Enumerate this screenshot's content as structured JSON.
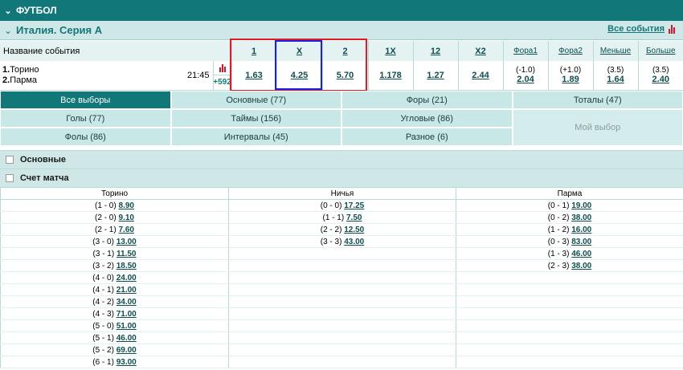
{
  "sport_title": "ФУТБОЛ",
  "league": {
    "name": "Италия. Серия А",
    "all_events": "Все события"
  },
  "odds_header": {
    "event_col": "Название события",
    "cols": [
      "1",
      "X",
      "2",
      "1X",
      "12",
      "X2",
      "Фора1",
      "Фора2",
      "Меньше",
      "Больше"
    ]
  },
  "event": {
    "team1_num": "1.",
    "team1": "Торино",
    "team2_num": "2.",
    "team2": "Парма",
    "time": "21:45",
    "more": "+592",
    "odds": [
      "1.63",
      "4.25",
      "5.70",
      "1.178",
      "1.27",
      "2.44"
    ],
    "fora1": {
      "hc": "(-1.0)",
      "odd": "2.04"
    },
    "fora2": {
      "hc": "(+1.0)",
      "odd": "1.89"
    },
    "under": {
      "hc": "(3.5)",
      "odd": "1.64"
    },
    "over": {
      "hc": "(3.5)",
      "odd": "2.40"
    }
  },
  "filters": {
    "row1": [
      "Все выборы",
      "Основные (77)",
      "Форы (21)",
      "Тоталы (47)"
    ],
    "row2": [
      "Голы (77)",
      "Таймы (156)",
      "Угловые (86)"
    ],
    "row3": [
      "Фолы (86)",
      "Интервалы (45)",
      "Разное (6)"
    ],
    "my_choice": "Мой выбор"
  },
  "sections": {
    "main": "Основные",
    "score": "Счет матча"
  },
  "score_table": {
    "headers": [
      "Торино",
      "Ничья",
      "Парма"
    ],
    "torino": [
      [
        "(1 - 0)",
        "8.90"
      ],
      [
        "(2 - 0)",
        "9.10"
      ],
      [
        "(2 - 1)",
        "7.60"
      ],
      [
        "(3 - 0)",
        "13.00"
      ],
      [
        "(3 - 1)",
        "11.50"
      ],
      [
        "(3 - 2)",
        "18.50"
      ],
      [
        "(4 - 0)",
        "24.00"
      ],
      [
        "(4 - 1)",
        "21.00"
      ],
      [
        "(4 - 2)",
        "34.00"
      ],
      [
        "(4 - 3)",
        "71.00"
      ],
      [
        "(5 - 0)",
        "51.00"
      ],
      [
        "(5 - 1)",
        "46.00"
      ],
      [
        "(5 - 2)",
        "69.00"
      ],
      [
        "(6 - 1)",
        "93.00"
      ]
    ],
    "draw": [
      [
        "(0 - 0)",
        "17.25"
      ],
      [
        "(1 - 1)",
        "7.50"
      ],
      [
        "(2 - 2)",
        "12.50"
      ],
      [
        "(3 - 3)",
        "43.00"
      ]
    ],
    "parma": [
      [
        "(0 - 1)",
        "19.00"
      ],
      [
        "(0 - 2)",
        "38.00"
      ],
      [
        "(1 - 2)",
        "16.00"
      ],
      [
        "(0 - 3)",
        "83.00"
      ],
      [
        "(1 - 3)",
        "46.00"
      ],
      [
        "(2 - 3)",
        "38.00"
      ]
    ]
  },
  "colors": {
    "header_bg": "#127779",
    "highlight_red": "#e01b24",
    "highlight_blue": "#1d1ee0",
    "stats_icon": "#d2162c"
  }
}
